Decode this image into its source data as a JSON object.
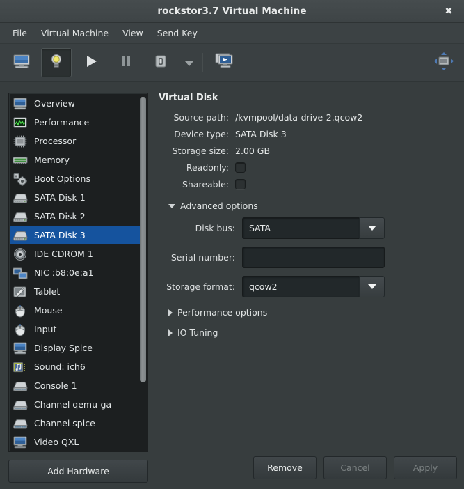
{
  "window": {
    "title": "rockstor3.7 Virtual Machine",
    "close_label": "✖"
  },
  "menubar": {
    "items": [
      {
        "label": "File"
      },
      {
        "label": "Virtual Machine"
      },
      {
        "label": "View"
      },
      {
        "label": "Send Key"
      }
    ]
  },
  "toolbar": {
    "buttons": [
      {
        "name": "show-console-view",
        "icon": "monitor-icon",
        "pressed": false
      },
      {
        "name": "show-hardware-details",
        "icon": "lightbulb-icon",
        "pressed": true
      },
      {
        "name": "run-vm",
        "icon": "play-icon",
        "pressed": false
      },
      {
        "name": "pause-vm",
        "icon": "pause-icon",
        "pressed": false
      },
      {
        "name": "shutdown-vm",
        "icon": "shutdown-icon",
        "pressed": false
      },
      {
        "name": "shutdown-menu",
        "icon": "chevron-down-icon",
        "pressed": false
      },
      {
        "name": "snapshots",
        "icon": "screens-play-icon",
        "pressed": false
      }
    ],
    "fullscreen_icon": "fullscreen-icon"
  },
  "sidebar": {
    "items": [
      {
        "label": "Overview",
        "icon": "monitor-icon"
      },
      {
        "label": "Performance",
        "icon": "performance-graph-icon"
      },
      {
        "label": "Processor",
        "icon": "cpu-icon"
      },
      {
        "label": "Memory",
        "icon": "memory-icon"
      },
      {
        "label": "Boot Options",
        "icon": "boot-gear-icon"
      },
      {
        "label": "SATA Disk 1",
        "icon": "harddisk-icon"
      },
      {
        "label": "SATA Disk 2",
        "icon": "harddisk-icon"
      },
      {
        "label": "SATA Disk 3",
        "icon": "harddisk-icon",
        "selected": true
      },
      {
        "label": "IDE CDROM 1",
        "icon": "cdrom-icon"
      },
      {
        "label": "NIC :b8:0e:a1",
        "icon": "network-icon"
      },
      {
        "label": "Tablet",
        "icon": "tablet-pen-icon"
      },
      {
        "label": "Mouse",
        "icon": "mouse-icon"
      },
      {
        "label": "Input",
        "icon": "mouse-icon"
      },
      {
        "label": "Display Spice",
        "icon": "monitor-icon"
      },
      {
        "label": "Sound: ich6",
        "icon": "sound-icon"
      },
      {
        "label": "Console 1",
        "icon": "serial-console-icon"
      },
      {
        "label": "Channel qemu-ga",
        "icon": "serial-console-icon"
      },
      {
        "label": "Channel spice",
        "icon": "serial-console-icon"
      },
      {
        "label": "Video QXL",
        "icon": "monitor-icon"
      }
    ],
    "add_hardware_label": "Add Hardware",
    "selection_color": "#15539e"
  },
  "detail": {
    "title": "Virtual Disk",
    "fields": [
      {
        "label": "Source path:",
        "value": "/kvmpool/data-drive-2.qcow2"
      },
      {
        "label": "Device type:",
        "value": "SATA Disk 3"
      },
      {
        "label": "Storage size:",
        "value": "2.00 GB"
      }
    ],
    "checkboxes": [
      {
        "label": "Readonly:",
        "checked": false
      },
      {
        "label": "Shareable:",
        "checked": false
      }
    ],
    "advanced": {
      "label": "Advanced options",
      "expanded": true,
      "disk_bus": {
        "label": "Disk bus:",
        "value": "SATA"
      },
      "serial_number": {
        "label": "Serial number:",
        "value": "",
        "placeholder": ""
      },
      "storage_format": {
        "label": "Storage format:",
        "value": "qcow2"
      }
    },
    "performance_options": {
      "label": "Performance options",
      "expanded": false
    },
    "io_tuning": {
      "label": "IO Tuning",
      "expanded": false
    }
  },
  "actions": {
    "remove": {
      "label": "Remove",
      "enabled": true
    },
    "cancel": {
      "label": "Cancel",
      "enabled": false
    },
    "apply": {
      "label": "Apply",
      "enabled": false
    }
  }
}
